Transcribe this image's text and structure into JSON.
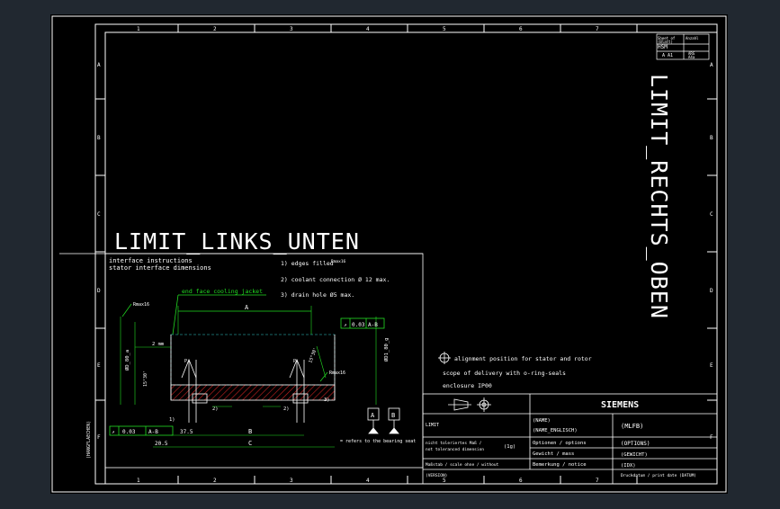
{
  "drawing": {
    "title_left": "LIMIT_LINKS_UNTEN",
    "title_right": "LIMIT_RECHTS_OBEN",
    "column_numbers": [
      "1",
      "2",
      "3",
      "4",
      "5",
      "6",
      "7"
    ],
    "row_letters": [
      "A",
      "B",
      "C",
      "D",
      "E",
      "F"
    ],
    "side_label": "(HANGFLAECHEN)",
    "interface": {
      "heading1": "interface instructions",
      "heading2": "stator interface dimensions",
      "note1": "1) edges filled",
      "note1_sub": "Rmax16",
      "note2": "2) coolant connection Ø 12 max.",
      "note3": "3) drain hole  Ø5 max.",
      "green_label": "end face cooling jacket",
      "rmax_left": "Rmax16",
      "rmax_right": "Rmax16",
      "dim_A": "A",
      "dim_B": "B",
      "dim_C": "C",
      "dim_2mm": "2 mm",
      "dim_15deg": "15°30'",
      "dim_15deg_r": "15°30'",
      "dim_dia_left": "ØD_80_a",
      "dim_dia_right": "ØD1_80_g",
      "tol_top_val": "0.03",
      "tol_top_ref": "A-B",
      "tol_bot_val": "0.03",
      "tol_bot_ref": "A-B",
      "dim_205": "20.5",
      "dim_375": "37.5",
      "marker_1": "1)",
      "marker_2": "2)",
      "marker_2b": "2)",
      "marker_3": "3)",
      "datum_A": "A",
      "datum_B": "B",
      "bearing_note": "= refers to the bearing seat",
      "p1": "P",
      "p2": "P"
    },
    "notes_right": {
      "align": "alignment position for stator and rotor",
      "scope": "scope of delivery with o-ring-seals",
      "enclosure": "enclosure IP00"
    },
    "title_block": {
      "brand": "SIEMENS",
      "limit": "LIMIT",
      "name": "(NAME)",
      "name_en": "(NAME_ENGLISCH)",
      "mlfb": "(MLFB)",
      "tol1": "nicht toleriertes Maß /",
      "tol2": "not toleranced dimension",
      "tol_val": "(1g)",
      "options_label": "Optionen / options",
      "options_val": "(OPTIONS)",
      "weight_label": "Gewicht / mass",
      "weight_val": "(GEWICHT)",
      "remark_label": "Bemerkung / notice",
      "remark_val": "(IDX)",
      "scale_label": "Maßstab / scale  ohne / without",
      "version_label": "(VERSION)",
      "doc_label": "Druckdatum / print date  (DATUM)",
      "sheet_hdr": "Sheet of",
      "sheet_hdr2": "(Blatt)",
      "sheet_hdr3": "Anzahl",
      "sheet_size": "A A1",
      "corner_code": "HSM",
      "small1": "ARG",
      "small2": "A4a"
    },
    "colors": {
      "background": "#000000",
      "frame_bg": "#212830",
      "line": "#ffffff",
      "green": "#22dd22",
      "hatch": "#cc2222",
      "cyan": "#33cccc"
    }
  }
}
